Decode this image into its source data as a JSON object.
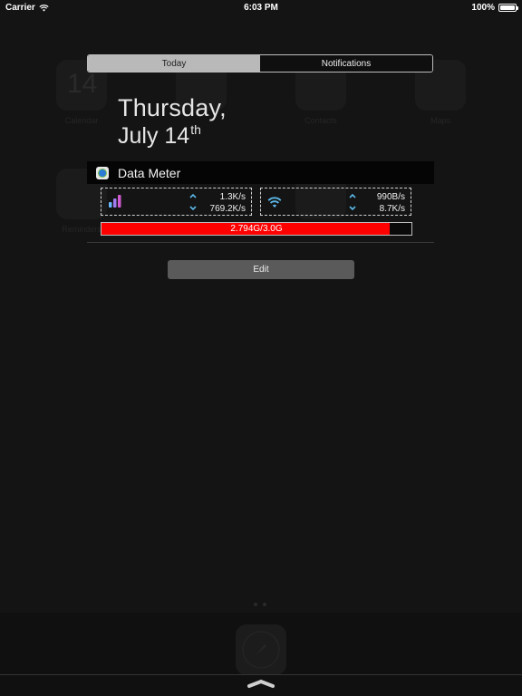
{
  "status_bar": {
    "carrier": "Carrier",
    "time": "6:03 PM",
    "battery": "100%"
  },
  "background_labels": {
    "calendar_day": "14",
    "calendar": "Calendar",
    "contacts": "Contacts",
    "maps": "Maps",
    "reminders": "Reminders"
  },
  "tabs": [
    {
      "label": "Today",
      "active": true
    },
    {
      "label": "Notifications",
      "active": false
    }
  ],
  "date": {
    "weekday": "Thursday,",
    "month_day": "July 14",
    "ordinal": "th"
  },
  "widget": {
    "title": "Data Meter",
    "cellular": {
      "up": "1.3K/s",
      "down": "769.2K/s"
    },
    "wifi": {
      "up": "990B/s",
      "down": "8.7K/s"
    },
    "usage": {
      "label": "2.794G/3.0G",
      "fraction": 0.931,
      "color": "#ff0000"
    }
  },
  "edit_label": "Edit",
  "colors": {
    "accent_blue": "#5ab8e8",
    "cellular_bars": [
      "#6ab7ff",
      "#a07cf0",
      "#d05ad0"
    ]
  }
}
